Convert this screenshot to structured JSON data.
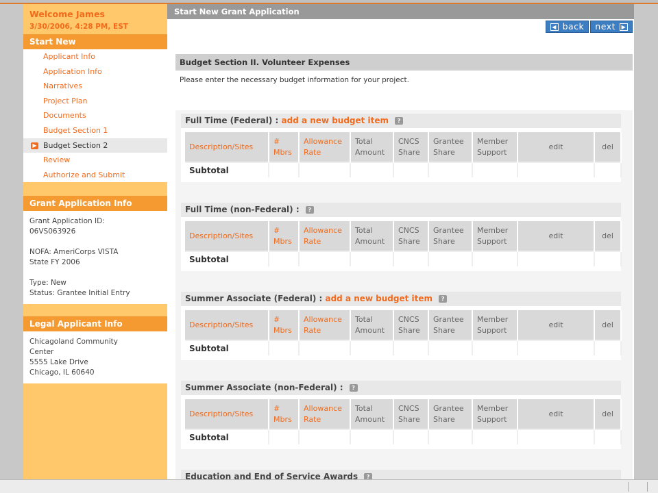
{
  "sidebar": {
    "welcome_name": "Welcome James",
    "welcome_date": "3/30/2006, 4:28 PM, EST",
    "start_new_header": "Start New",
    "nav_items": [
      {
        "label": "Applicant Info"
      },
      {
        "label": "Application Info"
      },
      {
        "label": "Narratives"
      },
      {
        "label": "Project Plan"
      },
      {
        "label": "Documents"
      },
      {
        "label": "Budget Section 1"
      },
      {
        "label": "Budget Section 2",
        "active": true
      },
      {
        "label": "Review"
      },
      {
        "label": "Authorize and Submit"
      }
    ],
    "grant_info_header": "Grant Application Info",
    "grant_id_label": "Grant Application ID:",
    "grant_id": "06VS063926",
    "nofa_label": "NOFA: AmeriCorps VISTA",
    "nofa_fy": "State FY 2006",
    "type": "Type: New",
    "status": "Status: Grantee Initial Entry",
    "legal_header": "Legal Applicant Info",
    "legal_name_1": "Chicagoland Community",
    "legal_name_2": "Center",
    "legal_address": "5555 Lake Drive",
    "legal_city": "Chicago, IL 60640"
  },
  "main": {
    "title": "Start New Grant Application",
    "back_label": "back",
    "next_label": "next",
    "section_title": "Budget Section II. Volunteer Expenses",
    "intro": "Please enter the necessary budget information for your project.",
    "columns": [
      "Description/Sites",
      "# Mbrs",
      "Allowance Rate",
      "Total Amount",
      "CNCS Share",
      "Grantee Share",
      "Member Support",
      "edit",
      "del"
    ],
    "subtotal_label": "Subtotal",
    "add_label": "add a new budget item",
    "blocks": [
      {
        "title": "Full Time (Federal) :",
        "has_add": true
      },
      {
        "title": "Full Time (non-Federal) :",
        "has_add": false
      },
      {
        "title": "Summer Associate (Federal) :",
        "has_add": true
      },
      {
        "title": "Summer Associate (non-Federal) :",
        "has_add": false
      }
    ],
    "last_block_title": "Education and End of Service Awards"
  },
  "colors": {
    "accent_orange": "#f26a1b",
    "sidebar_yellow": "#ffc96b",
    "header_orange": "#f59a31",
    "button_blue": "#3d7dc2"
  }
}
